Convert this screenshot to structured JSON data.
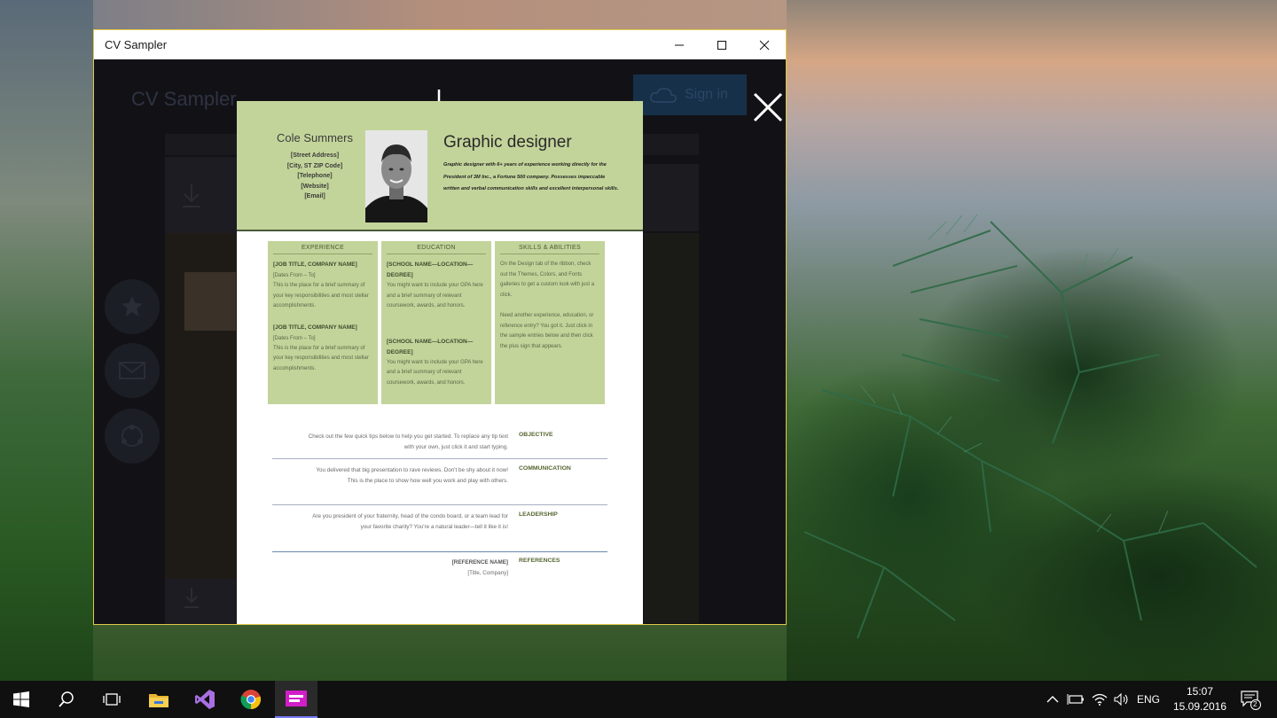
{
  "window": {
    "title": "CV Sampler",
    "border_color": "#e1c84a"
  },
  "background_app": {
    "title": "CV Sampler",
    "signin_label": "Sign in"
  },
  "cv": {
    "name": "Cole Summers",
    "contact": [
      "[Street Address]",
      "[City, ST ZIP Code]",
      "[Telephone]",
      "[Website]",
      "[Email]"
    ],
    "job_title": "Graphic designer",
    "summary": "Graphic designer with 6+ years of experience working directly for the President of 3M Inc., a Fortune 500 company. Possesses impeccable written and verbal communication skills and excellent interpersonal skills.",
    "header_color": "#c3d49a",
    "columns": [
      {
        "heading": "EXPERIENCE",
        "items": [
          {
            "title": "[JOB TITLE, COMPANY NAME]",
            "sub": "[Dates From – To]",
            "text": "This is the place for a brief summary of your key responsibilities and most stellar accomplishments."
          },
          {
            "title": "[JOB TITLE, COMPANY NAME]",
            "sub": "[Dates From – To]",
            "text": "This is the place for a brief summary of your key responsibilities and most stellar accomplishments."
          }
        ]
      },
      {
        "heading": "EDUCATION",
        "items": [
          {
            "title": "[SCHOOL NAME—LOCATION—DEGREE]",
            "sub": "",
            "text": "You might want to include your GPA here and a brief summary of relevant coursework, awards, and honors."
          },
          {
            "title": "[SCHOOL NAME—LOCATION—DEGREE]",
            "sub": "",
            "text": "You might want to include your GPA here and a brief summary of relevant coursework, awards, and honors."
          }
        ]
      },
      {
        "heading": "SKILLS & ABILITIES",
        "items": [
          {
            "title": "",
            "sub": "",
            "text": "On the Design tab of the ribbon, check out the Themes, Colors, and Fonts galleries to get a custom look with just a click."
          },
          {
            "title": "",
            "sub": "",
            "text": "Need another experience, education, or reference entry? You got it. Just click in the sample entries below and then click the plus sign that appears."
          }
        ]
      }
    ],
    "sections": [
      {
        "label": "OBJECTIVE",
        "lines": [
          "Check out the few quick tips below to help you get started. To replace any tip text",
          "with your own, just click it and start typing."
        ]
      },
      {
        "label": "COMMUNICATION",
        "lines": [
          "You delivered that big presentation to rave reviews. Don't be shy about it now!",
          "This is the place to show how well you work and play with others."
        ]
      },
      {
        "label": "LEADERSHIP",
        "lines": [
          "Are you president of your fraternity, head of the condo board, or a team lead for",
          "your favorite charity? You're a natural leader—tell it like it is!"
        ]
      },
      {
        "label": "REFERENCES",
        "lines": [
          "[REFERENCE NAME]",
          "[Title, Company]"
        ]
      }
    ]
  },
  "taskbar": {
    "apps": [
      "start-icon",
      "search-icon",
      "task-view-icon",
      "file-explorer-icon",
      "visual-studio-icon",
      "chrome-icon",
      "cv-sampler-icon"
    ],
    "language": "ENG",
    "time": "15:07",
    "date": "15.09.2016",
    "notification_count": "2"
  }
}
